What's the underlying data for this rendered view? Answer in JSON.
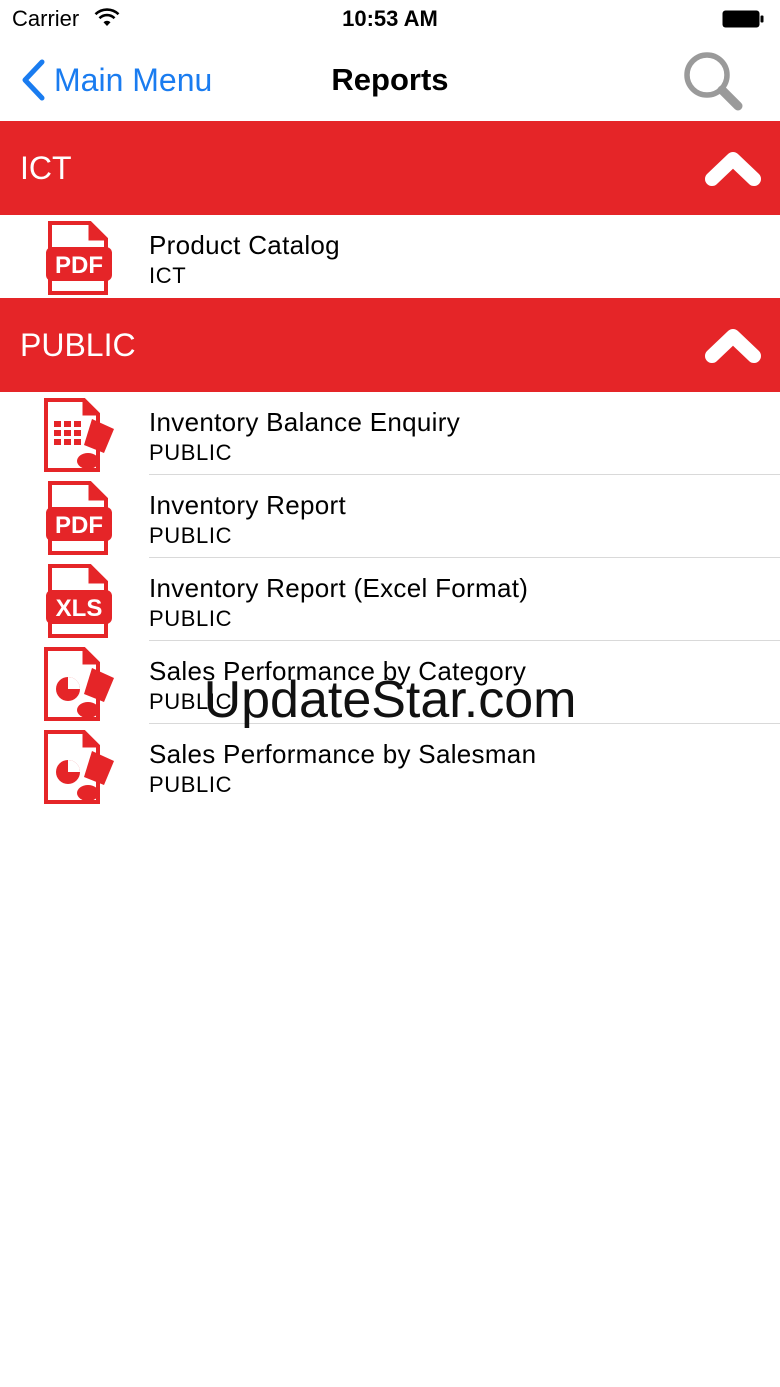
{
  "status_bar": {
    "carrier": "Carrier",
    "time": "10:53 AM"
  },
  "nav": {
    "back_label": "Main Menu",
    "title": "Reports"
  },
  "colors": {
    "accent_red": "#e52528",
    "ios_blue": "#1a7cf0"
  },
  "sections": [
    {
      "title": "ICT",
      "items": [
        {
          "title": "Product Catalog",
          "subtitle": "ICT",
          "icon": "pdf-icon"
        }
      ]
    },
    {
      "title": "PUBLIC",
      "items": [
        {
          "title": "Inventory Balance Enquiry",
          "subtitle": "PUBLIC",
          "icon": "spreadsheet-icon"
        },
        {
          "title": "Inventory Report",
          "subtitle": "PUBLIC",
          "icon": "pdf-icon"
        },
        {
          "title": "Inventory Report (Excel Format)",
          "subtitle": "PUBLIC",
          "icon": "xls-icon"
        },
        {
          "title": "Sales Performance by Category",
          "subtitle": "PUBLIC",
          "icon": "pie-chart-report-icon"
        },
        {
          "title": "Sales Performance by Salesman",
          "subtitle": "PUBLIC",
          "icon": "pie-chart-report-icon"
        }
      ]
    }
  ],
  "icon_labels": {
    "pdf": "PDF",
    "xls": "XLS"
  },
  "watermark": "UpdateStar.com"
}
